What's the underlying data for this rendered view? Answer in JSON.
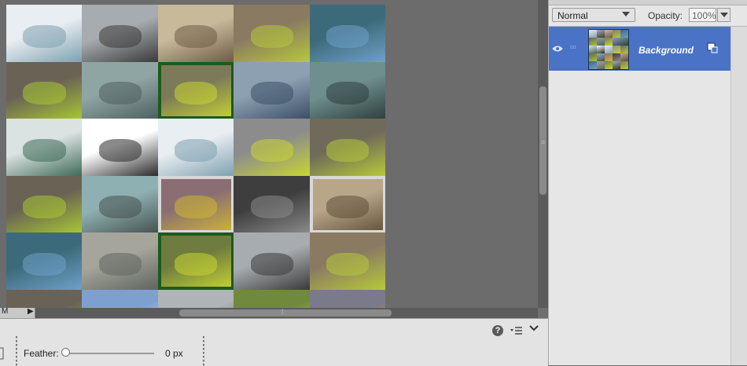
{
  "canvas": {
    "tiles": [
      {
        "name": "tile-bird-cartoon",
        "shade": "#e9eef2",
        "accent": "#7ea0b0"
      },
      {
        "name": "tile-robot-chrome",
        "shade": "#a7acb0",
        "accent": "#3a3a3a"
      },
      {
        "name": "tile-bridge-sepia",
        "shade": "#c9b99b",
        "accent": "#6d5c45"
      },
      {
        "name": "tile-group-street",
        "shade": "#8a7a62",
        "accent": "#b6c93a"
      },
      {
        "name": "tile-pride-poster",
        "shade": "#3c6a7a",
        "accent": "#6fa0c9"
      },
      {
        "name": "tile-group-street-2",
        "shade": "#6a6255",
        "accent": "#a8c832"
      },
      {
        "name": "tile-bulb-robot",
        "shade": "#8fa5a3",
        "accent": "#4e5f60"
      },
      {
        "name": "tile-group-green-frame",
        "shade": "#7c7a58",
        "accent": "#c8d632"
      },
      {
        "name": "tile-robot-flag",
        "shade": "#8da0b2",
        "accent": "#3a4e66"
      },
      {
        "name": "tile-robot-teal",
        "shade": "#6f8e8e",
        "accent": "#2f3e3e"
      },
      {
        "name": "tile-bulb",
        "shade": "#dbe2e2",
        "accent": "#3d6a55"
      },
      {
        "name": "tile-robot-black",
        "shade": "#ffffff",
        "accent": "#2a2a2a"
      },
      {
        "name": "tile-bird-cartoon-2",
        "shade": "#e9eef2",
        "accent": "#7ea0b0"
      },
      {
        "name": "tile-group-table-bw",
        "shade": "#8c8c8c",
        "accent": "#c8d632"
      },
      {
        "name": "tile-group-street-3",
        "shade": "#6f6a5a",
        "accent": "#b6c93a"
      },
      {
        "name": "tile-group-street-4",
        "shade": "#6a6255",
        "accent": "#a8c832"
      },
      {
        "name": "tile-robot-sea",
        "shade": "#8fb0b2",
        "accent": "#45524f"
      },
      {
        "name": "tile-group-framed",
        "shade": "#8a6e74",
        "accent": "#d0b830"
      },
      {
        "name": "tile-robot-dark",
        "shade": "#3e3e3e",
        "accent": "#8a8a8a"
      },
      {
        "name": "tile-group-sepia-frame",
        "shade": "#b9a689",
        "accent": "#5e4e38"
      },
      {
        "name": "tile-pride-poster-2",
        "shade": "#3c6a7a",
        "accent": "#6fa0c9"
      },
      {
        "name": "tile-group-cafe",
        "shade": "#a5a59b",
        "accent": "#5e665e"
      },
      {
        "name": "tile-group-green-frame-2",
        "shade": "#6f7c3f",
        "accent": "#c8d632"
      },
      {
        "name": "tile-robot-chrome-2",
        "shade": "#a7acb0",
        "accent": "#3a3a3a"
      },
      {
        "name": "tile-group-street-5",
        "shade": "#8a7a62",
        "accent": "#b6c93a"
      },
      {
        "name": "tile-group-street-6",
        "shade": "#6a6255",
        "accent": "#a8c832"
      },
      {
        "name": "tile-cloud-blue",
        "shade": "#7ea0d0",
        "accent": "#f2f2f2"
      },
      {
        "name": "tile-robot-grey",
        "shade": "#b0b4b6",
        "accent": "#4a4a4a"
      },
      {
        "name": "tile-group-bright",
        "shade": "#6f8a3c",
        "accent": "#e6e640"
      },
      {
        "name": "tile-group-sunset",
        "shade": "#7a7a8a",
        "accent": "#d08a40"
      }
    ]
  },
  "layers_panel": {
    "blend_mode": "Normal",
    "opacity_label": "Opacity:",
    "opacity_value": "100%",
    "layer_name": "Background"
  },
  "tool_options": {
    "feather_label": "Feather:",
    "feather_value": "0 px",
    "feather_level": 0,
    "help_label": "?"
  },
  "colors": {
    "layer_selected": "#4a73c6",
    "panel_bg": "#e6e6e6",
    "canvas_bg": "#6c6c6c"
  }
}
